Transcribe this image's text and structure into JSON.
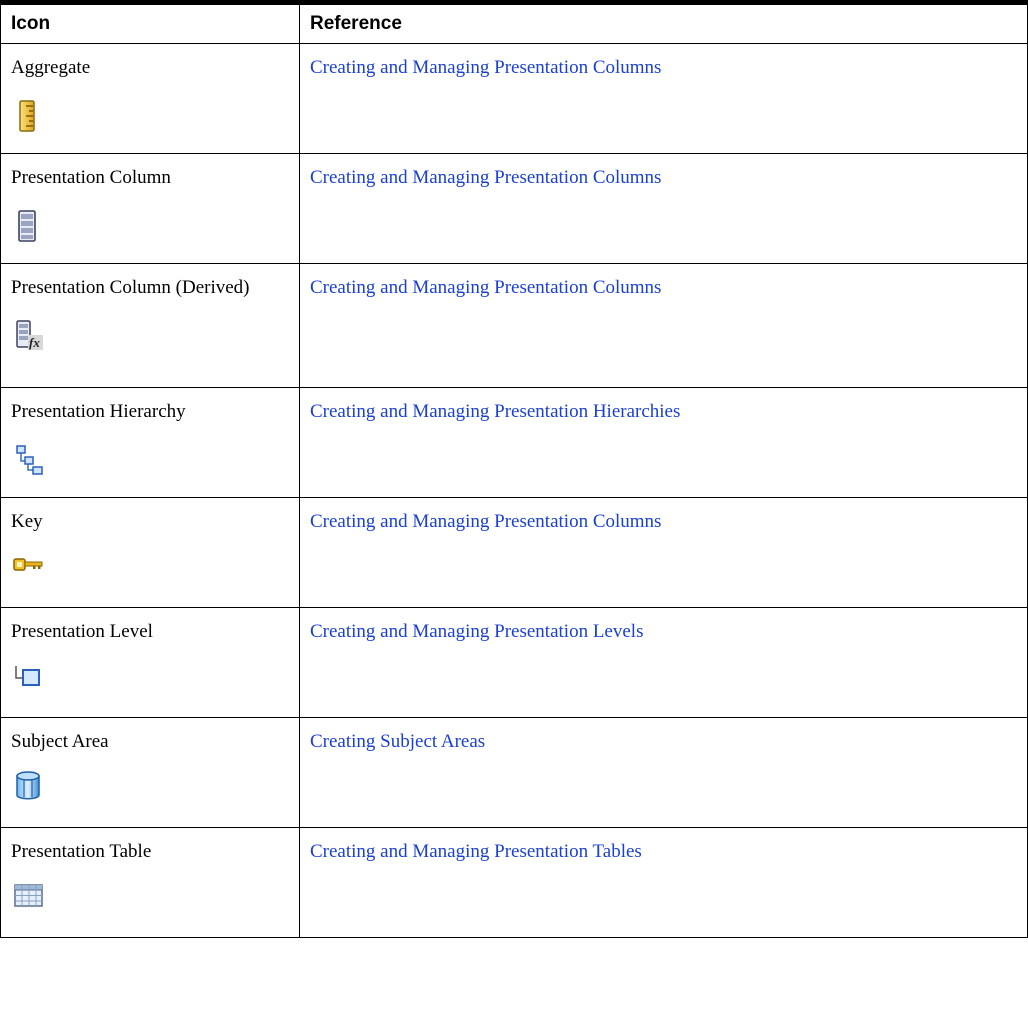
{
  "table": {
    "header": {
      "icon": "Icon",
      "reference": "Reference"
    },
    "rows": [
      {
        "name": "Aggregate",
        "icon": "aggregate-ruler-icon",
        "reference": "Creating and Managing Presentation Columns"
      },
      {
        "name": "Presentation Column",
        "icon": "presentation-column-icon",
        "reference": "Creating and Managing Presentation Columns"
      },
      {
        "name": "Presentation Column (Derived)",
        "icon": "derived-column-fx-icon",
        "reference": "Creating and Managing Presentation Columns"
      },
      {
        "name": "Presentation Hierarchy",
        "icon": "hierarchy-icon",
        "reference": "Creating and Managing Presentation Hierarchies"
      },
      {
        "name": "Key",
        "icon": "key-icon",
        "reference": "Creating and Managing Presentation Columns"
      },
      {
        "name": "Presentation Level",
        "icon": "level-icon",
        "reference": "Creating and Managing Presentation Levels"
      },
      {
        "name": "Subject Area",
        "icon": "subject-area-cylinder-icon",
        "reference": "Creating Subject Areas"
      },
      {
        "name": "Presentation Table",
        "icon": "table-grid-icon",
        "reference": "Creating and Managing Presentation Tables"
      }
    ]
  },
  "colors": {
    "link": "#1a3fd1",
    "border": "#000000"
  }
}
